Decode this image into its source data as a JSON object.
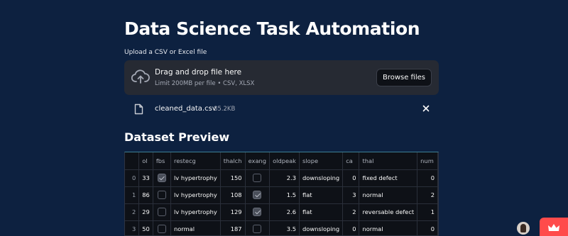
{
  "page": {
    "title": "Data Science Task Automation"
  },
  "uploader": {
    "label": "Upload a CSV or Excel file",
    "drop_title": "Drag and drop file here",
    "drop_sub": "Limit 200MB per file • CSV, XLSX",
    "browse_label": "Browse files",
    "icons": {
      "upload": "cloud-upload-icon",
      "file": "file-icon",
      "remove": "close-icon"
    }
  },
  "uploaded_file": {
    "name": "cleaned_data.csv",
    "size": "85.2KB"
  },
  "preview": {
    "heading": "Dataset Preview",
    "columns": [
      "",
      "ol",
      "fbs",
      "restecg",
      "thalch",
      "exang",
      "oldpeak",
      "slope",
      "ca",
      "thal",
      "num"
    ],
    "rows": [
      {
        "index": "0",
        "ol": "33",
        "fbs": true,
        "restecg": "lv hypertrophy",
        "thalch": "150",
        "exang": false,
        "oldpeak": "2.3",
        "slope": "downsloping",
        "ca": "0",
        "thal": "fixed defect",
        "num": "0"
      },
      {
        "index": "1",
        "ol": "86",
        "fbs": false,
        "restecg": "lv hypertrophy",
        "thalch": "108",
        "exang": true,
        "oldpeak": "1.5",
        "slope": "flat",
        "ca": "3",
        "thal": "normal",
        "num": "2"
      },
      {
        "index": "2",
        "ol": "29",
        "fbs": false,
        "restecg": "lv hypertrophy",
        "thalch": "129",
        "exang": true,
        "oldpeak": "2.6",
        "slope": "flat",
        "ca": "2",
        "thal": "reversable defect",
        "num": "1"
      },
      {
        "index": "3",
        "ol": "50",
        "fbs": false,
        "restecg": "normal",
        "thalch": "187",
        "exang": false,
        "oldpeak": "3.5",
        "slope": "downsloping",
        "ca": "0",
        "thal": "normal",
        "num": "0"
      }
    ]
  },
  "colors": {
    "background": "#0d2140",
    "accent": "#ff4b4b",
    "panel": "#262a33"
  }
}
